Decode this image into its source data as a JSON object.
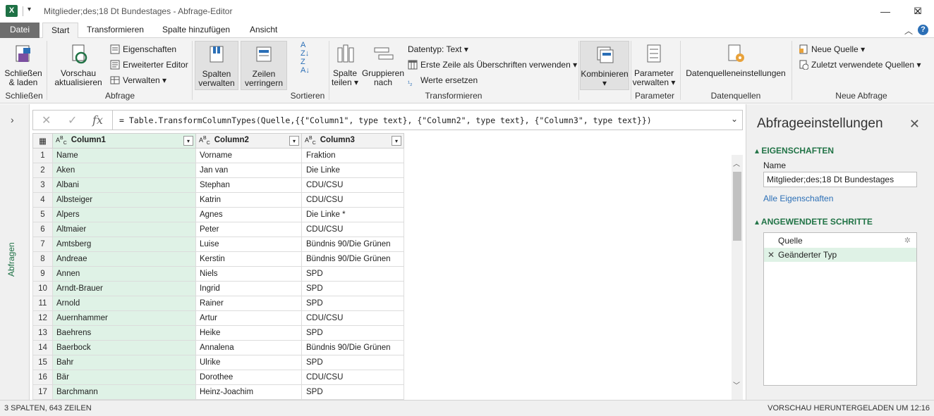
{
  "window": {
    "title": "Mitglieder;des;18 Dt Bundestages - Abfrage-Editor",
    "app_icon": "excel-icon",
    "controls": [
      "—",
      "☐",
      "✕"
    ]
  },
  "tabs": {
    "file": "Datei",
    "items": [
      "Start",
      "Transformieren",
      "Spalte hinzufügen",
      "Ansicht"
    ],
    "active": "Start"
  },
  "ribbon": {
    "close": {
      "label1": "Schließen",
      "label2": "& laden",
      "group": "Schließen"
    },
    "query": {
      "refresh1": "Vorschau",
      "refresh2": "aktualisieren",
      "properties": "Eigenschaften",
      "advanced_editor": "Erweiterter Editor",
      "manage": "Verwalten",
      "group": "Abfrage"
    },
    "columns": {
      "l1": "Spalten",
      "l2": "verwalten"
    },
    "rows": {
      "l1": "Zeilen",
      "l2": "verringern"
    },
    "sort": {
      "group": "Sortieren"
    },
    "transform": {
      "split1": "Spalte",
      "split2": "teilen",
      "group_by1": "Gruppieren",
      "group_by2": "nach",
      "datatype": "Datentyp: Text",
      "first_row_header": "Erste Zeile als Überschriften verwenden",
      "replace_values": "Werte ersetzen",
      "group": "Transformieren"
    },
    "combine": {
      "label": "Kombinieren"
    },
    "parameters": {
      "l1": "Parameter",
      "l2": "verwalten",
      "group": "Parameter"
    },
    "datasources": {
      "label": "Datenquelleneinstellungen",
      "group": "Datenquellen"
    },
    "new_query": {
      "new_source": "Neue Quelle",
      "recent_sources": "Zuletzt verwendete Quellen",
      "group": "Neue Abfrage"
    }
  },
  "leftnav": {
    "label": "Abfragen"
  },
  "formula_bar": {
    "text": "= Table.TransformColumnTypes(Quelle,{{\"Column1\", type text}, {\"Column2\", type text}, {\"Column3\", type text}})"
  },
  "grid": {
    "columns": [
      {
        "name": "Column1",
        "type": "ABC"
      },
      {
        "name": "Column2",
        "type": "ABC"
      },
      {
        "name": "Column3",
        "type": "ABC"
      }
    ],
    "rows": [
      [
        "1",
        "Name",
        "Vorname",
        "Fraktion"
      ],
      [
        "2",
        "Aken",
        "Jan van",
        " Die Linke"
      ],
      [
        "3",
        "Albani",
        "Stephan",
        "CDU/CSU"
      ],
      [
        "4",
        "Albsteiger",
        "Katrin",
        "CDU/CSU"
      ],
      [
        "5",
        "Alpers",
        "Agnes",
        "Die Linke *"
      ],
      [
        "6",
        "Altmaier",
        "Peter",
        "CDU/CSU"
      ],
      [
        "7",
        "Amtsberg",
        "Luise",
        "Bündnis 90/Die Grünen"
      ],
      [
        "8",
        "Andreae",
        "Kerstin",
        "Bündnis 90/Die Grünen"
      ],
      [
        "9",
        "Annen",
        "Niels",
        "SPD"
      ],
      [
        "10",
        "Arndt-Brauer",
        "Ingrid",
        "SPD"
      ],
      [
        "11",
        "Arnold",
        "Rainer",
        "SPD"
      ],
      [
        "12",
        "Auernhammer",
        "Artur",
        "CDU/CSU"
      ],
      [
        "13",
        "Baehrens",
        "Heike",
        "SPD"
      ],
      [
        "14",
        "Baerbock",
        "Annalena",
        "Bündnis 90/Die Grünen"
      ],
      [
        "15",
        "Bahr",
        "Ulrike",
        "SPD"
      ],
      [
        "16",
        "Bär",
        "Dorothee",
        "CDU/CSU"
      ],
      [
        "17",
        "Barchmann",
        "Heinz-Joachim",
        "SPD"
      ]
    ]
  },
  "settings_panel": {
    "title": "Abfrageeinstellungen",
    "properties_header": "EIGENSCHAFTEN",
    "name_label": "Name",
    "name_value": "Mitglieder;des;18 Dt Bundestages",
    "all_properties": "Alle Eigenschaften",
    "steps_header": "ANGEWENDETE SCHRITTE",
    "steps": [
      "Quelle",
      "Geänderter Typ"
    ]
  },
  "status": {
    "left": "3 SPALTEN, 643 ZEILEN",
    "right": "VORSCHAU HERUNTERGELADEN UM 12:16"
  },
  "colors": {
    "accent_green": "#217346",
    "selected_col": "#dff2e6"
  }
}
